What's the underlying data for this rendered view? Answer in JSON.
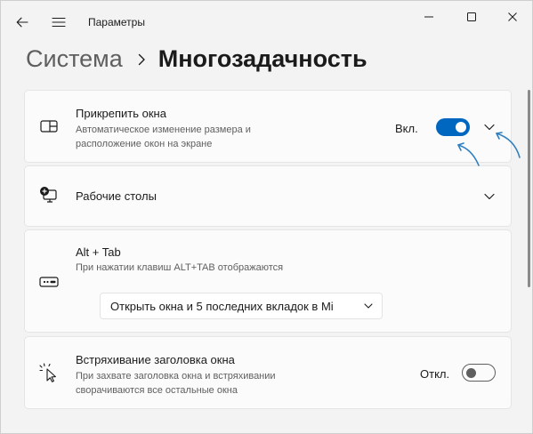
{
  "window": {
    "title": "Параметры",
    "icons": {
      "back": "arrow-left-icon",
      "menu": "hamburger-menu-icon",
      "minimize": "minimize-icon",
      "maximize": "maximize-icon",
      "close": "close-icon"
    }
  },
  "breadcrumb": {
    "parent": "Система",
    "current": "Многозадачность"
  },
  "snap": {
    "title": "Прикрепить окна",
    "desc_line1": "Автоматическое изменение размера и",
    "desc_line2": "расположение окон на экране",
    "state": "Вкл.",
    "enabled": true,
    "icon": "snap-layout-icon"
  },
  "desktops": {
    "title": "Рабочие столы",
    "icon": "virtual-desktops-icon"
  },
  "alttab": {
    "title": "Alt + Tab",
    "desc": "При нажатии клавиш ALT+TAB отображаются",
    "selected": "Открыть окна и 5 последних вкладок в Mi",
    "icon": "keyboard-keys-icon"
  },
  "shake": {
    "title": "Встряхивание заголовка окна",
    "desc_line1": "При захвате заголовка окна и встряхивании",
    "desc_line2": "сворачиваются все остальные окна",
    "state": "Откл.",
    "enabled": false,
    "icon": "shake-cursor-icon"
  },
  "colors": {
    "accent": "#0067c0",
    "annotation": "#2f7fc1"
  }
}
